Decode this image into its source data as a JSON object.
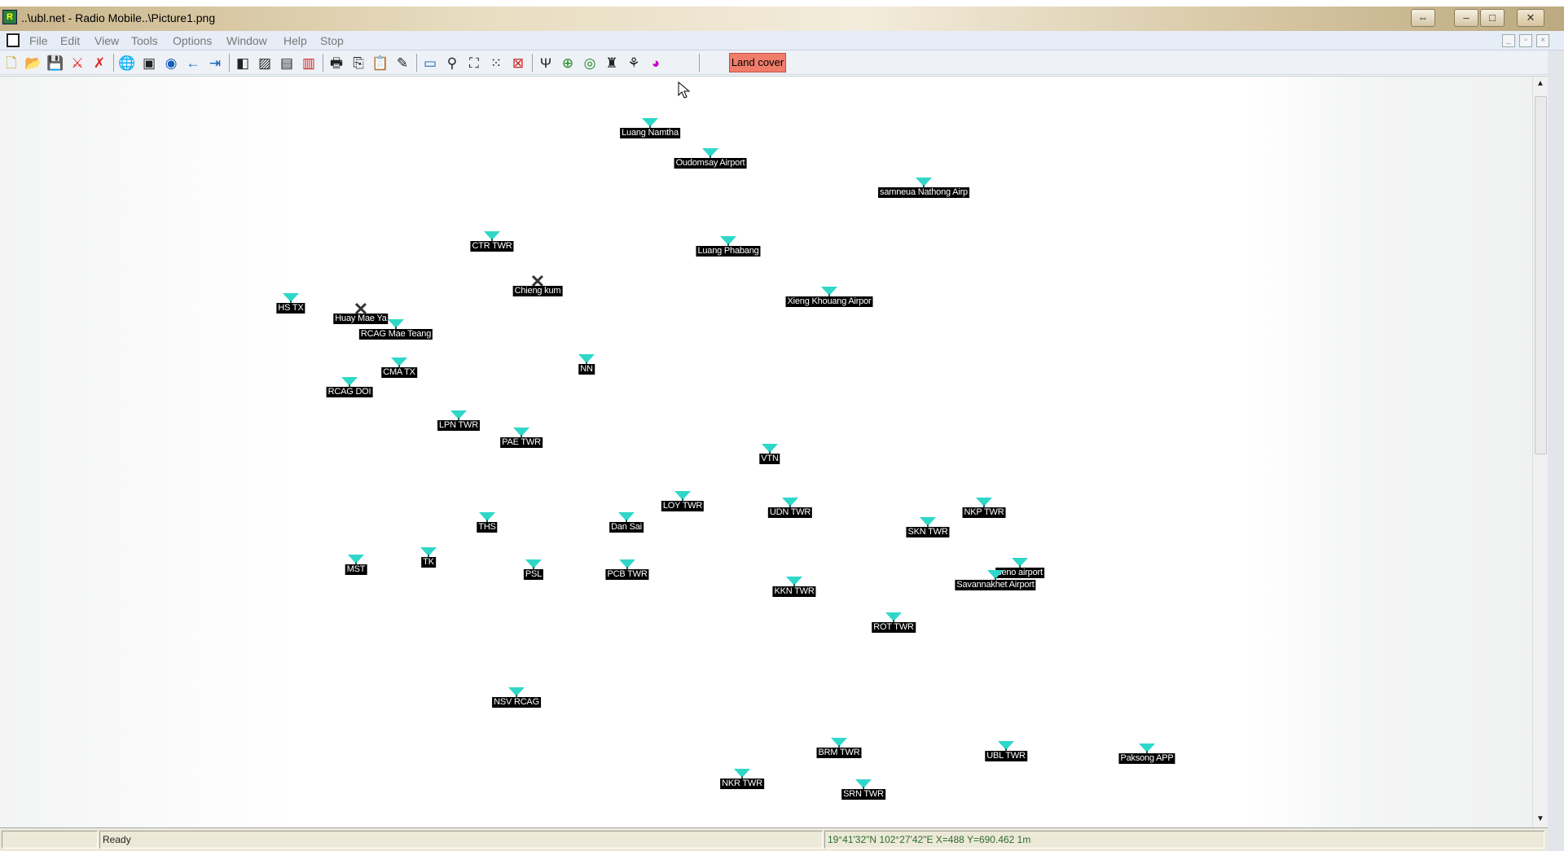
{
  "window": {
    "title": "..\\ubl.net - Radio Mobile..\\Picture1.png",
    "app_icon": "radio-mobile-icon"
  },
  "menubar": {
    "items": [
      "File",
      "Edit",
      "View",
      "Tools",
      "Options",
      "Window",
      "Help",
      "Stop"
    ]
  },
  "toolbar": {
    "land_cover_label": "Land cover",
    "land_cover_color": "#f07d6a"
  },
  "map": {
    "antenna_color": "#2fd7c8",
    "sites": [
      {
        "label": "Luang Namtha",
        "type": "antenna"
      },
      {
        "label": "Oudomsay Airport",
        "type": "antenna"
      },
      {
        "label": "samneua Nathong Airp",
        "type": "antenna"
      },
      {
        "label": "CTR TWR",
        "type": "antenna"
      },
      {
        "label": "Luang Phabang",
        "type": "antenna"
      },
      {
        "label": "Chieng kum",
        "type": "cross"
      },
      {
        "label": "Xieng Khouang Airpor",
        "type": "antenna"
      },
      {
        "label": "HS TX",
        "type": "antenna"
      },
      {
        "label": "Huay Mae Ya",
        "type": "cross"
      },
      {
        "label": "RCAG Mae Teang",
        "type": "antenna"
      },
      {
        "label": "NN",
        "type": "antenna"
      },
      {
        "label": "CMA TX",
        "type": "antenna"
      },
      {
        "label": "RCAG DOI",
        "type": "antenna"
      },
      {
        "label": "LPN TWR",
        "type": "antenna"
      },
      {
        "label": "PAE TWR",
        "type": "antenna"
      },
      {
        "label": "VTN",
        "type": "antenna"
      },
      {
        "label": "LOY TWR",
        "type": "antenna"
      },
      {
        "label": "UDN TWR",
        "type": "antenna"
      },
      {
        "label": "NKP TWR",
        "type": "antenna"
      },
      {
        "label": "SKN TWR",
        "type": "antenna"
      },
      {
        "label": "THS",
        "type": "antenna"
      },
      {
        "label": "Dan Sai",
        "type": "antenna"
      },
      {
        "label": "TK",
        "type": "antenna"
      },
      {
        "label": "MST",
        "type": "antenna"
      },
      {
        "label": "PSL",
        "type": "antenna"
      },
      {
        "label": "PCB TWR",
        "type": "antenna"
      },
      {
        "label": "seno airport",
        "type": "antenna"
      },
      {
        "label": "Savannakhet Airport",
        "type": "antenna"
      },
      {
        "label": "KKN TWR",
        "type": "antenna"
      },
      {
        "label": "ROT TWR",
        "type": "antenna"
      },
      {
        "label": "NSV RCAG",
        "type": "antenna"
      },
      {
        "label": "BRM TWR",
        "type": "antenna"
      },
      {
        "label": "UBL TWR",
        "type": "antenna"
      },
      {
        "label": "Paksong APP",
        "type": "antenna"
      },
      {
        "label": "NKR TWR",
        "type": "antenna"
      },
      {
        "label": "SRN TWR",
        "type": "antenna"
      }
    ]
  },
  "statusbar": {
    "status": "Ready",
    "coordinates": "19°41'32\"N 102°27'42\"E  X=488 Y=690.462 1m"
  }
}
